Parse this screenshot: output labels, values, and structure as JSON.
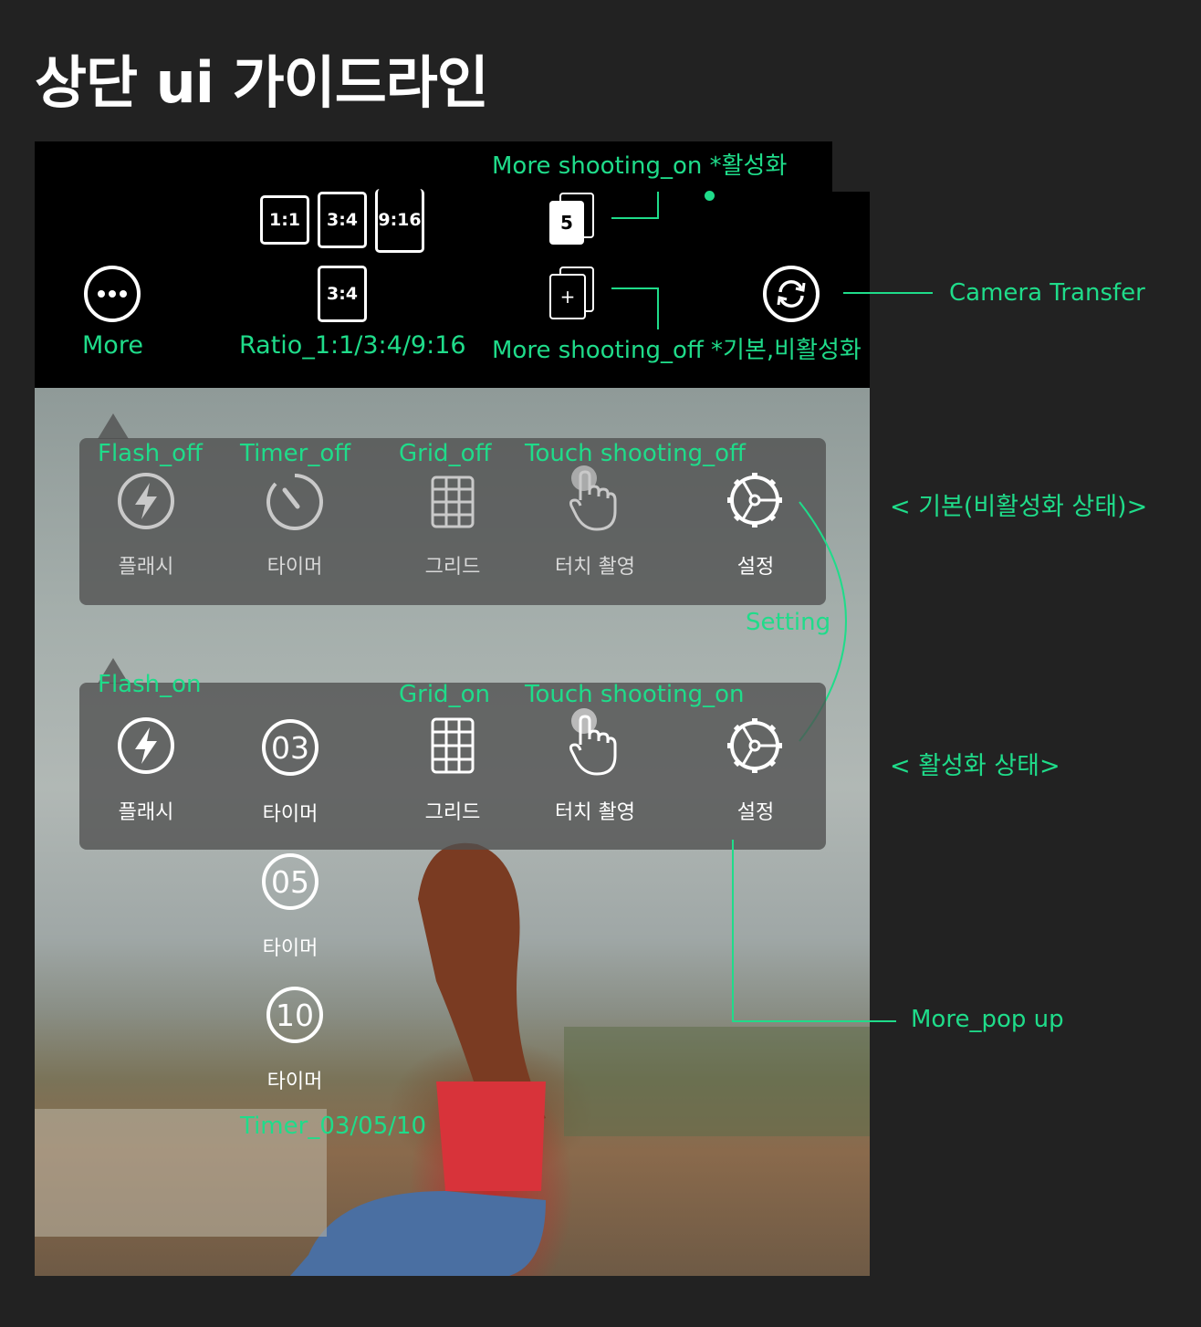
{
  "page_title": "상단 ui 가이드라인",
  "top_bar": {
    "more_label": "More",
    "ratio_options": [
      "1:1",
      "3:4",
      "9:16"
    ],
    "ratio_selected": "3:4",
    "ratio_caption": "Ratio_1:1/3:4/9:16",
    "more_shooting_on_caption": "More shooting_on *활성화",
    "more_shooting_on_count": "5",
    "more_shooting_off_caption": "More shooting_off *기본,비활성화",
    "more_shooting_off_symbol": "+",
    "camera_transfer_caption": "Camera Transfer"
  },
  "inactive_panel": {
    "section_note": "< 기본(비활성화 상태)>",
    "captions": [
      "Flash_off",
      "Timer_off",
      "Grid_off",
      "Touch shooting_off"
    ],
    "items": [
      {
        "label": "플래시",
        "icon": "flash-off-icon"
      },
      {
        "label": "타이머",
        "icon": "timer-off-icon"
      },
      {
        "label": "그리드",
        "icon": "grid-off-icon"
      },
      {
        "label": "터치 촬영",
        "icon": "touch-off-icon"
      },
      {
        "label": "설정",
        "icon": "settings-icon"
      }
    ]
  },
  "setting_caption": "Setting",
  "active_panel": {
    "section_note": "< 활성화 상태>",
    "captions": [
      "Flash_on",
      "Grid_on",
      "Touch shooting_on"
    ],
    "items": [
      {
        "label": "플래시",
        "icon": "flash-on-icon"
      },
      {
        "label": "타이머",
        "icon": "timer-03-icon",
        "value": "03"
      },
      {
        "label": "그리드",
        "icon": "grid-on-icon"
      },
      {
        "label": "터치 촬영",
        "icon": "touch-on-icon"
      },
      {
        "label": "설정",
        "icon": "settings-icon"
      }
    ]
  },
  "timer_options": [
    {
      "value": "05",
      "label": "타이머"
    },
    {
      "value": "10",
      "label": "타이머"
    }
  ],
  "timer_caption": "Timer_03/05/10",
  "more_popup_caption": "More_pop up",
  "colors": {
    "annotation": "#1fdc8a",
    "background": "#222222",
    "topbar": "#000000"
  }
}
